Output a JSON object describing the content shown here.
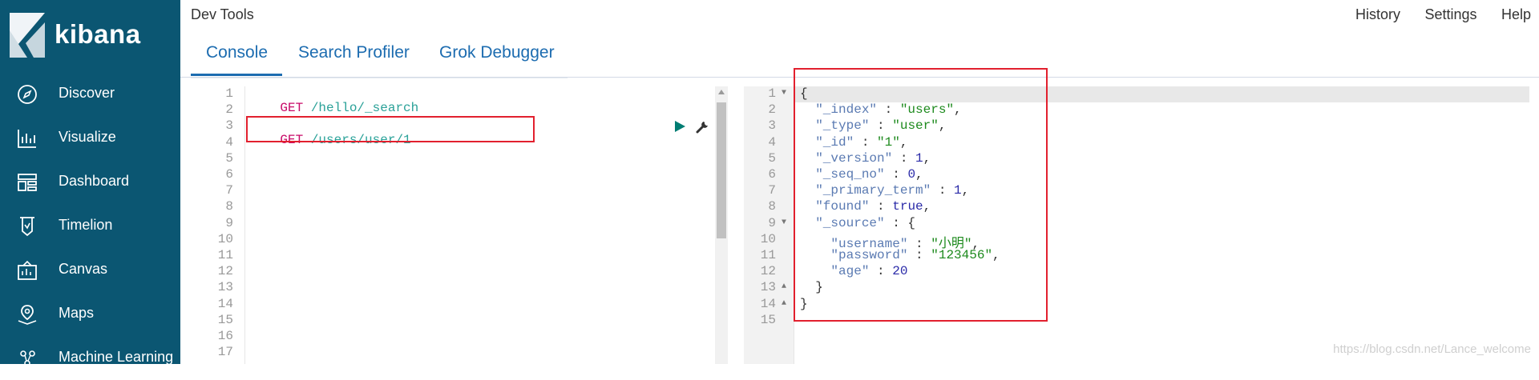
{
  "sidebar": {
    "brand": "kibana",
    "items": [
      {
        "label": "Discover",
        "icon": "compass-icon"
      },
      {
        "label": "Visualize",
        "icon": "chart-icon"
      },
      {
        "label": "Dashboard",
        "icon": "dashboard-icon"
      },
      {
        "label": "Timelion",
        "icon": "timelion-icon"
      },
      {
        "label": "Canvas",
        "icon": "canvas-icon"
      },
      {
        "label": "Maps",
        "icon": "map-icon"
      },
      {
        "label": "Machine Learning",
        "icon": "ml-icon"
      }
    ]
  },
  "header": {
    "title": "Dev Tools",
    "links": [
      "History",
      "Settings",
      "Help"
    ],
    "tabs": [
      "Console",
      "Search Profiler",
      "Grok Debugger"
    ],
    "active_tab": "Console"
  },
  "request_editor": {
    "line_numbers": [
      "1",
      "2",
      "3",
      "4",
      "5",
      "6",
      "7",
      "8",
      "9",
      "10",
      "11",
      "12",
      "13",
      "14",
      "15",
      "16",
      "17"
    ],
    "lines": [
      {
        "method": "GET",
        "path": " /hello/_search"
      },
      {
        "method": "",
        "path": ""
      },
      {
        "method": "GET",
        "path": " /users/user/1"
      }
    ]
  },
  "response_editor": {
    "line_numbers": [
      "1",
      "2",
      "3",
      "4",
      "5",
      "6",
      "7",
      "8",
      "9",
      "10",
      "11",
      "12",
      "13",
      "14",
      "15"
    ],
    "lines": [
      [
        {
          "t": "punct",
          "v": "{"
        }
      ],
      [
        {
          "t": "punct",
          "v": "  "
        },
        {
          "t": "key",
          "v": "\"_index\""
        },
        {
          "t": "punct",
          "v": " : "
        },
        {
          "t": "str",
          "v": "\"users\""
        },
        {
          "t": "punct",
          "v": ","
        }
      ],
      [
        {
          "t": "punct",
          "v": "  "
        },
        {
          "t": "key",
          "v": "\"_type\""
        },
        {
          "t": "punct",
          "v": " : "
        },
        {
          "t": "str",
          "v": "\"user\""
        },
        {
          "t": "punct",
          "v": ","
        }
      ],
      [
        {
          "t": "punct",
          "v": "  "
        },
        {
          "t": "key",
          "v": "\"_id\""
        },
        {
          "t": "punct",
          "v": " : "
        },
        {
          "t": "str",
          "v": "\"1\""
        },
        {
          "t": "punct",
          "v": ","
        }
      ],
      [
        {
          "t": "punct",
          "v": "  "
        },
        {
          "t": "key",
          "v": "\"_version\""
        },
        {
          "t": "punct",
          "v": " : "
        },
        {
          "t": "num",
          "v": "1"
        },
        {
          "t": "punct",
          "v": ","
        }
      ],
      [
        {
          "t": "punct",
          "v": "  "
        },
        {
          "t": "key",
          "v": "\"_seq_no\""
        },
        {
          "t": "punct",
          "v": " : "
        },
        {
          "t": "num",
          "v": "0"
        },
        {
          "t": "punct",
          "v": ","
        }
      ],
      [
        {
          "t": "punct",
          "v": "  "
        },
        {
          "t": "key",
          "v": "\"_primary_term\""
        },
        {
          "t": "punct",
          "v": " : "
        },
        {
          "t": "num",
          "v": "1"
        },
        {
          "t": "punct",
          "v": ","
        }
      ],
      [
        {
          "t": "punct",
          "v": "  "
        },
        {
          "t": "key",
          "v": "\"found\""
        },
        {
          "t": "punct",
          "v": " : "
        },
        {
          "t": "bool",
          "v": "true"
        },
        {
          "t": "punct",
          "v": ","
        }
      ],
      [
        {
          "t": "punct",
          "v": "  "
        },
        {
          "t": "key",
          "v": "\"_source\""
        },
        {
          "t": "punct",
          "v": " : {"
        }
      ],
      [
        {
          "t": "punct",
          "v": "    "
        },
        {
          "t": "key",
          "v": "\"username\""
        },
        {
          "t": "punct",
          "v": " : "
        },
        {
          "t": "str",
          "v": "\"小明\""
        },
        {
          "t": "punct",
          "v": ","
        }
      ],
      [
        {
          "t": "punct",
          "v": "    "
        },
        {
          "t": "key",
          "v": "\"password\""
        },
        {
          "t": "punct",
          "v": " : "
        },
        {
          "t": "str",
          "v": "\"123456\""
        },
        {
          "t": "punct",
          "v": ","
        }
      ],
      [
        {
          "t": "punct",
          "v": "    "
        },
        {
          "t": "key",
          "v": "\"age\""
        },
        {
          "t": "punct",
          "v": " : "
        },
        {
          "t": "num",
          "v": "20"
        }
      ],
      [
        {
          "t": "punct",
          "v": "  }"
        }
      ],
      [
        {
          "t": "punct",
          "v": "}"
        }
      ],
      [
        {
          "t": "punct",
          "v": ""
        }
      ]
    ],
    "fold_lines": [
      {
        "line": 1,
        "dir": "down"
      },
      {
        "line": 9,
        "dir": "down"
      },
      {
        "line": 13,
        "dir": "up"
      },
      {
        "line": 14,
        "dir": "up"
      }
    ]
  },
  "watermark": "https://blog.csdn.net/Lance_welcome",
  "colors": {
    "sidebar": "#0b5672",
    "accent": "#1c6cb0",
    "highlight": "#e2202e"
  }
}
